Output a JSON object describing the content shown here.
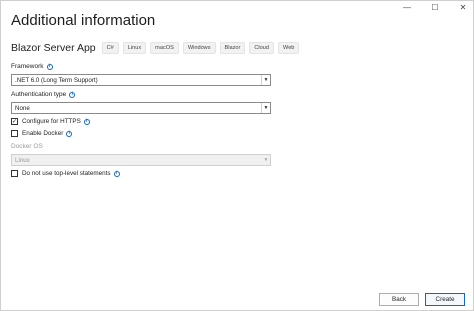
{
  "window": {
    "title": "Additional information",
    "controls": [
      "—",
      "☐",
      "✕"
    ]
  },
  "template": {
    "name": "Blazor Server App",
    "tags": [
      "C#",
      "Linux",
      "macOS",
      "Windows",
      "Blazor",
      "Cloud",
      "Web"
    ]
  },
  "framework": {
    "label": "Framework",
    "value": ".NET 6.0 (Long Term Support)"
  },
  "authentication": {
    "label": "Authentication type",
    "value": "None"
  },
  "https": {
    "label": "Configure for HTTPS",
    "checked": true
  },
  "docker": {
    "label": "Enable Docker",
    "checked": false
  },
  "docker_os": {
    "label": "Docker OS",
    "value": "Linux",
    "disabled": true
  },
  "top_level": {
    "label": "Do not use top-level statements",
    "checked": false
  },
  "buttons": {
    "back": "Back",
    "create": "Create"
  },
  "colors": {
    "accent": "#1565c0"
  }
}
